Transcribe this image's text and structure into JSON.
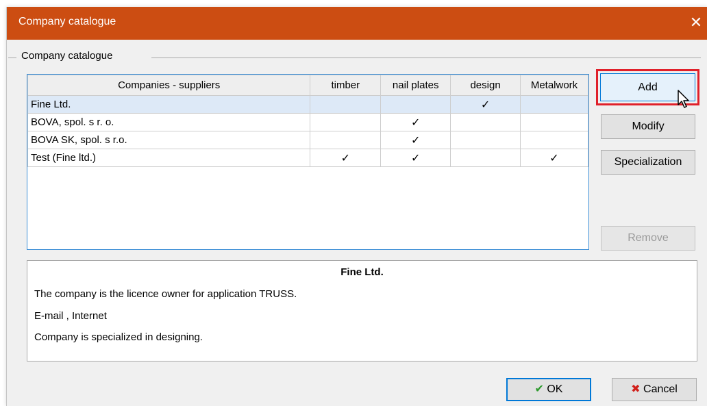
{
  "window": {
    "title": "Company catalogue",
    "close_glyph": "✕"
  },
  "group": {
    "label": "Company catalogue"
  },
  "table": {
    "headers": [
      "Companies - suppliers",
      "timber",
      "nail plates",
      "design",
      "Metalwork"
    ],
    "rows": [
      {
        "name": "Fine Ltd.",
        "timber": "",
        "nail_plates": "",
        "design": "✓",
        "metalwork": "",
        "selected": true
      },
      {
        "name": "BOVA, spol. s r. o.",
        "timber": "",
        "nail_plates": "✓",
        "design": "",
        "metalwork": ""
      },
      {
        "name": "BOVA SK, spol. s r.o.",
        "timber": "",
        "nail_plates": "✓",
        "design": "",
        "metalwork": ""
      },
      {
        "name": "Test (Fine ltd.)",
        "timber": "✓",
        "nail_plates": "✓",
        "design": "",
        "metalwork": "✓"
      }
    ]
  },
  "buttons": {
    "add": "Add",
    "modify": "Modify",
    "specialization": "Specialization",
    "remove": "Remove",
    "ok": "OK",
    "cancel": "Cancel"
  },
  "info": {
    "title": "Fine Ltd.",
    "lines": [
      "The company is the licence owner for application TRUSS.",
      "E-mail  , Internet",
      "Company is specialized in designing."
    ]
  },
  "colors": {
    "titlebar": "#cc4d12",
    "highlight": "#e0202a",
    "selection": "#dde9f7"
  }
}
